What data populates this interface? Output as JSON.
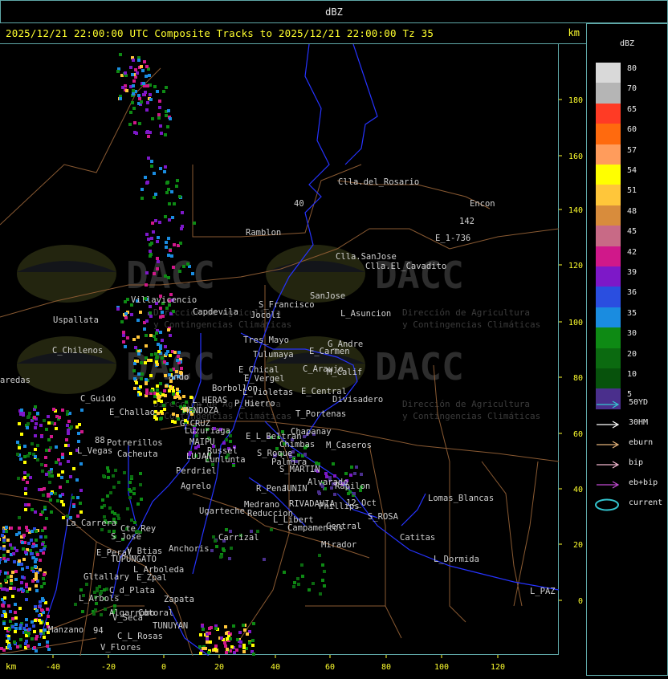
{
  "window_title": "dBZ",
  "header": {
    "title": "2025/12/21 22:00:00 UTC Composite Tracks to 2025/12/21 22:00:00 Tz 35",
    "unit": "km"
  },
  "axes": {
    "y_ticks": [
      "180",
      "160",
      "140",
      "120",
      "100",
      "80",
      "60",
      "40",
      "20",
      "0"
    ],
    "x_ticks": [
      "-40",
      "-20",
      "0",
      "20",
      "40",
      "60",
      "80",
      "100",
      "120"
    ],
    "x_unit": "km"
  },
  "watermark": {
    "brand": "DACC",
    "line1": "Dirección de Agricultura",
    "line2": "y Contingencias Climáticas"
  },
  "places": [
    "Clla.del_Rosario",
    "Encon",
    "142",
    "E_1-736",
    "Ramblon",
    "40",
    "Clla.SanJose",
    "Clla.El_Cavadito",
    "Villavicencio",
    "Uspallata",
    "Capdevila",
    "S_Francisco",
    "SanJose",
    "L_Asuncion",
    "Jocoli",
    "Tres_Mayo",
    "Tulumaya",
    "E_Carmen",
    "G_Andre",
    "C_Chilenos",
    "E_Chical",
    "C_Araujo",
    "M_Calif",
    "E_Vergel",
    "ando",
    "aredas",
    "Borbollon",
    "L_Violetas",
    "E_Central",
    "Divisadero",
    "L_HERAS",
    "P_Hierro",
    "C_Guido",
    "E_Challao",
    "MENDOZA",
    "T_Portenas",
    "G_CRUZ",
    "Luzuriaga",
    "E_L_Beltran",
    "Chapanay",
    "MAIPU",
    "88",
    "Potrerillos",
    "Chimbas",
    "M_Caseros",
    "L_Vegas",
    "Cacheuta",
    "Russel",
    "S_Roque",
    "LUJAN",
    "Lunlunta",
    "Palmira",
    "Perdriel",
    "S_MARTIN",
    "Alvarado",
    "Agrelo",
    "R_Pena",
    "JUNIN",
    "Rapilon",
    "Ugarteche",
    "Medrano",
    "RIVADAVIA",
    "Phillips",
    "12_Oct",
    "Lomas_Blancas",
    "Reduccion",
    "L_Libert",
    "La_Carrera",
    "Cte_Rey",
    "S_Jose",
    "S_ROSA",
    "Campamentos",
    "Central",
    "Carrizal",
    "Catitas",
    "V_Btias",
    "Anchoris",
    "E_Peral",
    "TUPUNGATO",
    "Mirador",
    "L_Dormida",
    "L_Arboleda",
    "Gltallary",
    "E_Zpal",
    "C_d_Plata",
    "L_PAZ",
    "L_Arbols",
    "Zapata",
    "Algarrobo",
    "Cotoral",
    "V_Seca",
    "TUNUYAN",
    "Manzano",
    "94",
    "C_L_Rosas",
    "V_Flores"
  ],
  "legend": {
    "title": "dBZ",
    "levels": [
      {
        "label": "80",
        "color": "#d9d9d9"
      },
      {
        "label": "70",
        "color": "#b5b5b5"
      },
      {
        "label": "65",
        "color": "#ff3b25"
      },
      {
        "label": "60",
        "color": "#ff6a0e"
      },
      {
        "label": "57",
        "color": "#ff9c5c"
      },
      {
        "label": "54",
        "color": "#ffff00"
      },
      {
        "label": "51",
        "color": "#ffc63a"
      },
      {
        "label": "48",
        "color": "#d88c3c"
      },
      {
        "label": "45",
        "color": "#c86a86"
      },
      {
        "label": "42",
        "color": "#d0188a"
      },
      {
        "label": "39",
        "color": "#7d18c8"
      },
      {
        "label": "36",
        "color": "#2a4ee0"
      },
      {
        "label": "35",
        "color": "#1a8ce0"
      },
      {
        "label": "30",
        "color": "#0e8a14"
      },
      {
        "label": "20",
        "color": "#0b6a10"
      },
      {
        "label": "10",
        "color": "#07520c"
      },
      {
        "label": "5",
        "color": "#4a2f8c"
      }
    ],
    "tracks": [
      {
        "label": "50YD",
        "color": "#34c6d0",
        "kind": "arrow"
      },
      {
        "label": "30HM",
        "color": "#ffffff",
        "kind": "arrow"
      },
      {
        "label": "eburn",
        "color": "#e3b27a",
        "kind": "arrow"
      },
      {
        "label": "bip",
        "color": "#f2b8d0",
        "kind": "arrow"
      },
      {
        "label": "eb+bip",
        "color": "#c14ad2",
        "kind": "arrow"
      },
      {
        "label": "current",
        "color": "#34c6d0",
        "kind": "ellipse"
      }
    ]
  }
}
